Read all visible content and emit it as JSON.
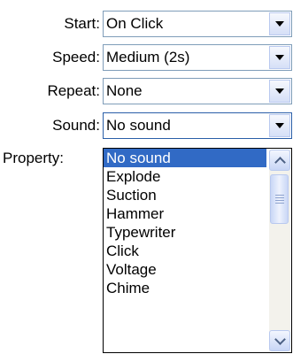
{
  "fields": [
    {
      "label": "Start:",
      "value": "On Click"
    },
    {
      "label": "Speed:",
      "value": "Medium (2s)"
    },
    {
      "label": "Repeat:",
      "value": "None"
    },
    {
      "label": "Sound:",
      "value": "No sound"
    }
  ],
  "property_label": "Property:",
  "sound_options": [
    "No sound",
    "Explode",
    "Suction",
    "Hammer",
    "Typewriter",
    "Click",
    "Voltage",
    "Chime"
  ],
  "selected_option": "No sound",
  "colors": {
    "selection": "#316ac5",
    "combo_border": "#7f9db9"
  }
}
